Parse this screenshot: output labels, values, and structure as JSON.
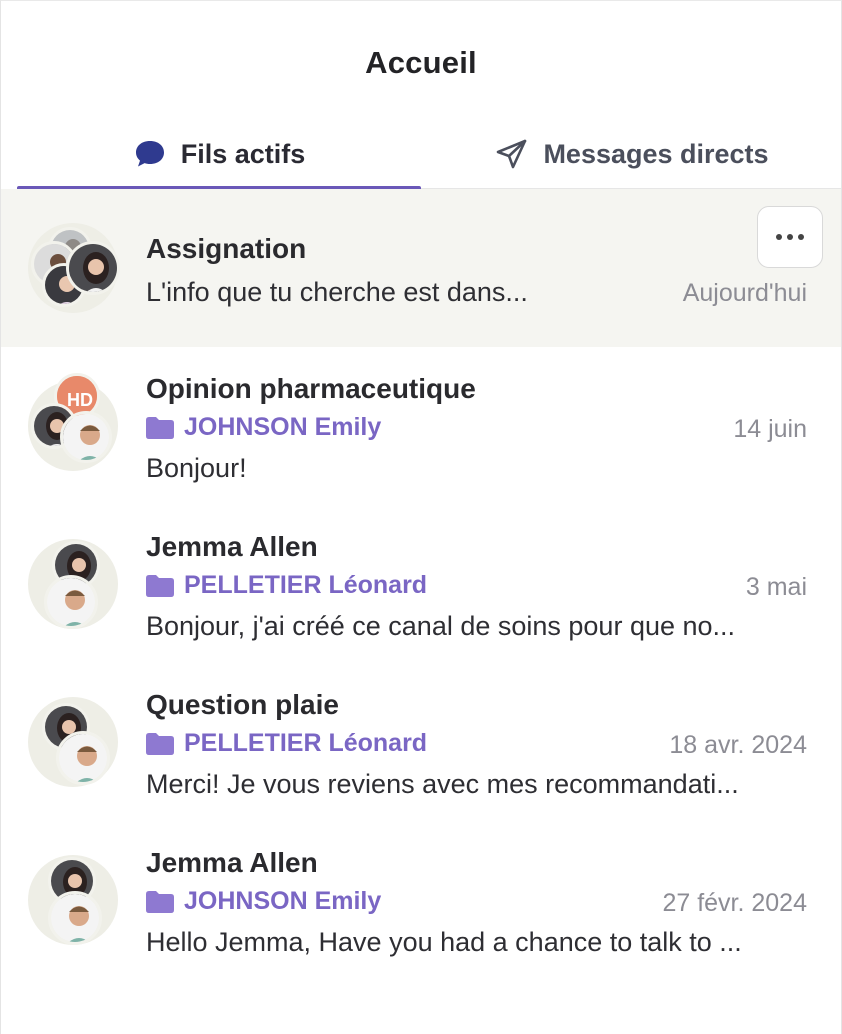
{
  "header": {
    "title": "Accueil"
  },
  "tabs": [
    {
      "label": "Fils actifs",
      "icon": "chat-bubble-icon",
      "active": true
    },
    {
      "label": "Messages directs",
      "icon": "paper-plane-icon",
      "active": false
    }
  ],
  "colors": {
    "accent": "#6a58b8",
    "folder": "#7a66c4",
    "highlight_row": "#f5f5f1",
    "date": "#8c8c94"
  },
  "threads": [
    {
      "title": "Assignation",
      "preview": "L'info que tu cherche est dans...",
      "date": "Aujourd'hui",
      "folder": "",
      "avatar_initials": ""
    },
    {
      "title": "Opinion pharmaceutique",
      "preview": "Bonjour!",
      "date": "14 juin",
      "folder": "JOHNSON Emily",
      "avatar_initials": "HD"
    },
    {
      "title": "Jemma Allen",
      "preview": "Bonjour, j'ai créé ce canal de soins pour que no...",
      "date": "3 mai",
      "folder": "PELLETIER Léonard",
      "avatar_initials": ""
    },
    {
      "title": "Question plaie",
      "preview": "Merci! Je vous reviens avec mes recommandati...",
      "date": "18 avr. 2024",
      "folder": "PELLETIER Léonard",
      "avatar_initials": ""
    },
    {
      "title": "Jemma Allen",
      "preview": "Hello Jemma, Have you had a chance to talk to ...",
      "date": "27 févr. 2024",
      "folder": "JOHNSON Emily",
      "avatar_initials": ""
    }
  ],
  "more_button_icon": "more-horizontal-icon"
}
